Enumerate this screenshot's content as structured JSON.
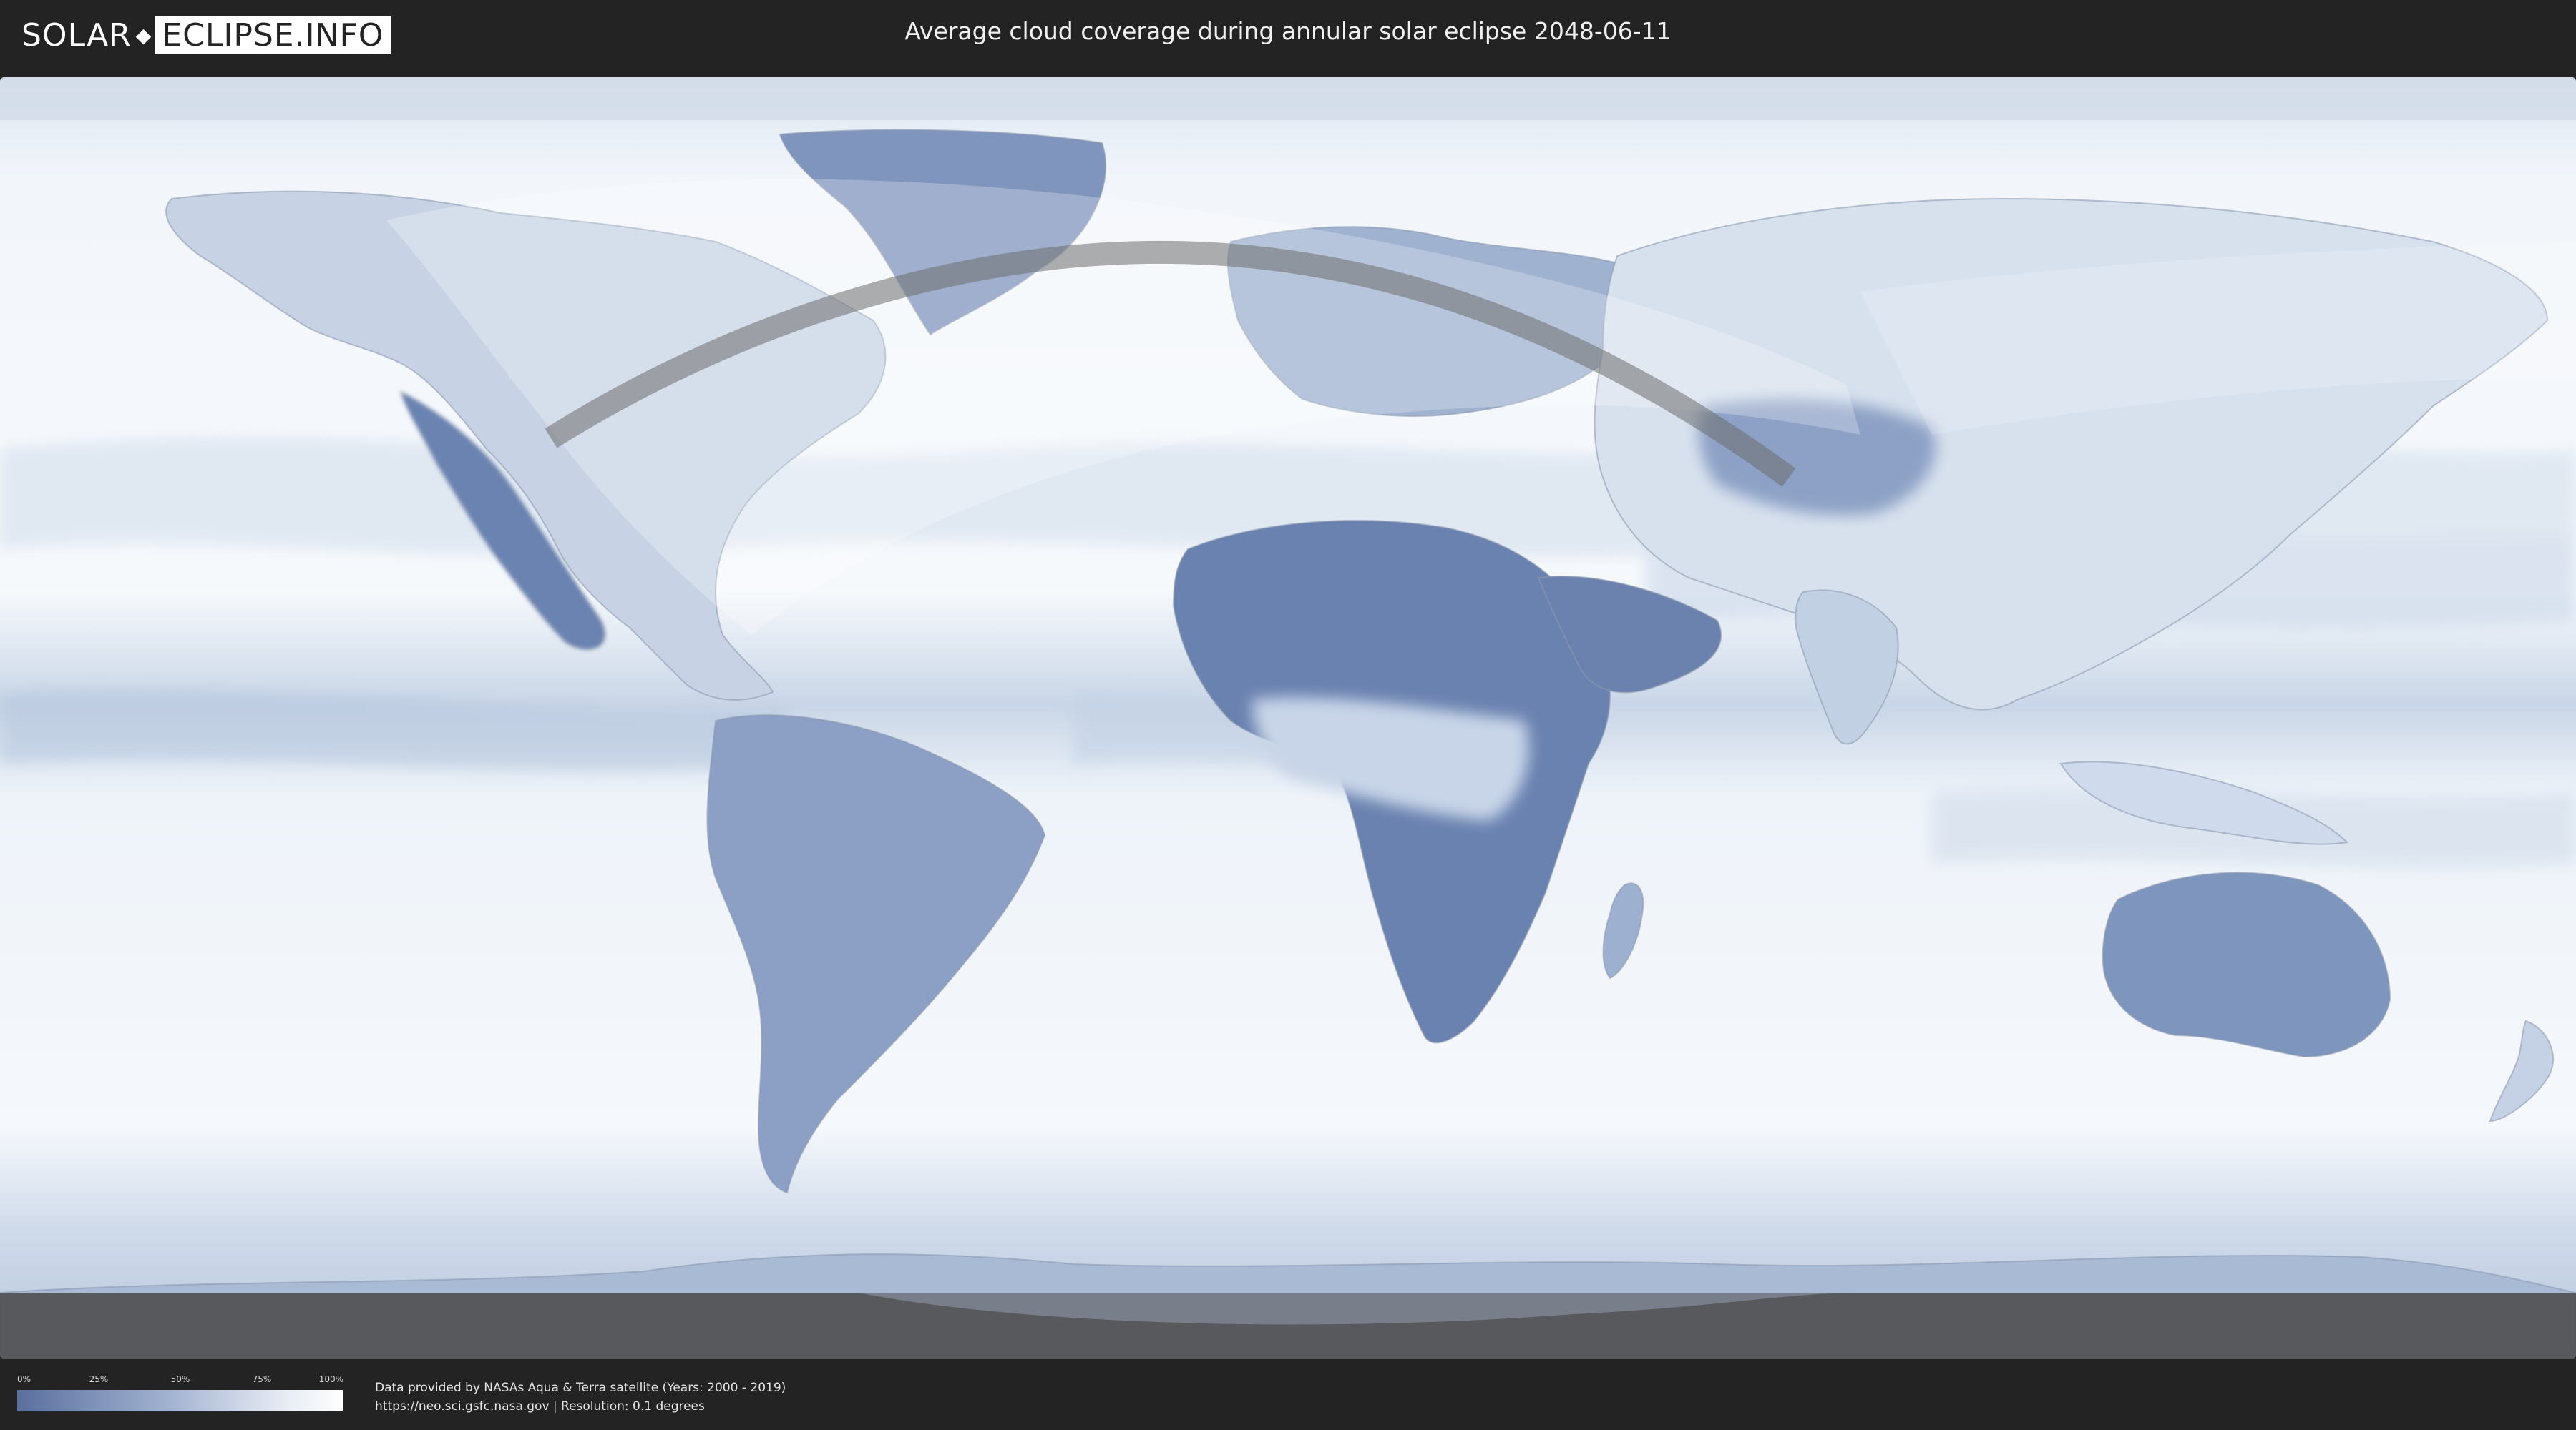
{
  "header": {
    "logo_left": "SOLAR",
    "logo_right": "ECLIPSE.INFO",
    "title": "Average cloud coverage during annular solar eclipse 2048-06-11"
  },
  "legend": {
    "ticks": [
      "0%",
      "25%",
      "50%",
      "75%",
      "100%"
    ],
    "gradient_colors": [
      "#5a6f9e",
      "#9fb0cf",
      "#e4e9f2",
      "#ffffff"
    ]
  },
  "credits": {
    "line1": "Data provided by NASAs Aqua & Terra satellite (Years: 2000 - 2019)",
    "line2": "https://neo.sci.gsfc.nasa.gov | Resolution: 0.1 degrees"
  },
  "colors": {
    "background": "#232323",
    "ocean_cloud": "#eef3f9",
    "land_clear": "#5b74a4",
    "eclipse_path": "#6e6e6e"
  }
}
